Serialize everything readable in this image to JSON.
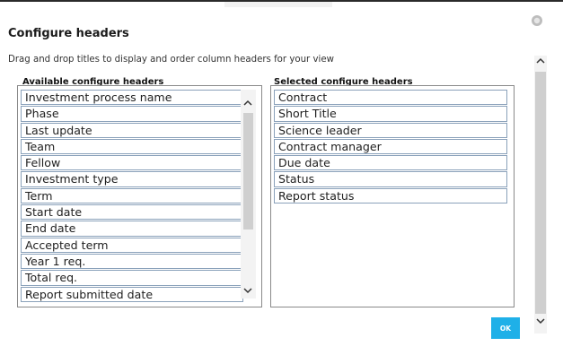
{
  "dialog": {
    "title": "Configure headers",
    "hint": "Drag and drop titles to display and order column headers for your view"
  },
  "available": {
    "heading": "Available configure headers",
    "items": [
      "Investment process name",
      "Phase",
      "Last update",
      "Team",
      "Fellow",
      "Investment type",
      "Term",
      "Start date",
      "End date",
      "Accepted term",
      "Year 1 req.",
      "Total req.",
      "Report submitted date"
    ]
  },
  "selected": {
    "heading": "Selected configure headers",
    "items": [
      "Contract",
      "Short Title",
      "Science leader",
      "Contract manager",
      "Due date",
      "Status",
      "Report status"
    ]
  },
  "actions": {
    "ok_label": "OK"
  },
  "icons": {
    "close": "close-icon",
    "scroll_up": "chevron-up-icon",
    "scroll_down": "chevron-down-icon"
  },
  "colors": {
    "ok_button": "#1fb0e8",
    "item_border": "#8aa1ba"
  }
}
